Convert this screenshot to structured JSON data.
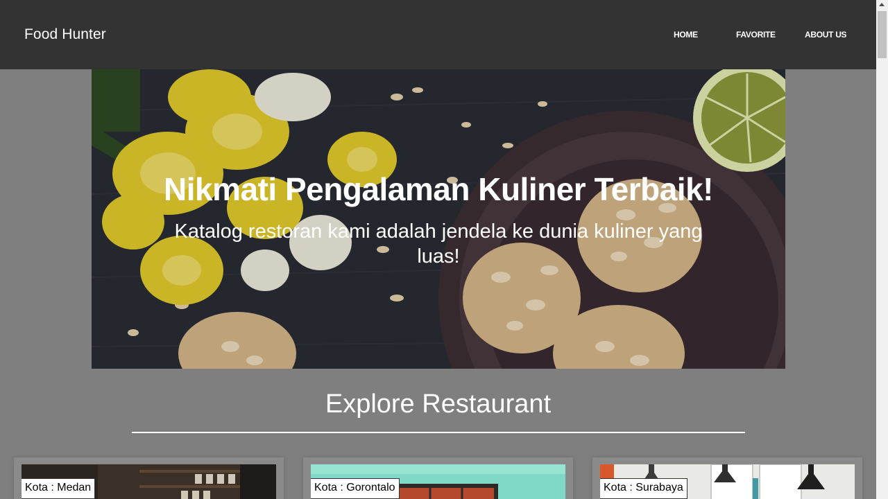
{
  "nav": {
    "brand": "Food Hunter",
    "links": [
      "HOME",
      "FAVORITE",
      "ABOUT US"
    ]
  },
  "hero": {
    "title": "Nikmati Pengalaman Kuliner Terbaik!",
    "subtitle": "Katalog restoran kami adalah jendela ke dunia kuliner yang luas!"
  },
  "explore": {
    "title": "Explore Restaurant"
  },
  "restaurants": [
    {
      "city": "Kota : Medan"
    },
    {
      "city": "Kota : Gorontalo"
    },
    {
      "city": "Kota : Surabaya"
    }
  ],
  "colors": {
    "navbar": "#333333",
    "page_background": "#7f7f7f",
    "text_light": "#ffffff"
  }
}
